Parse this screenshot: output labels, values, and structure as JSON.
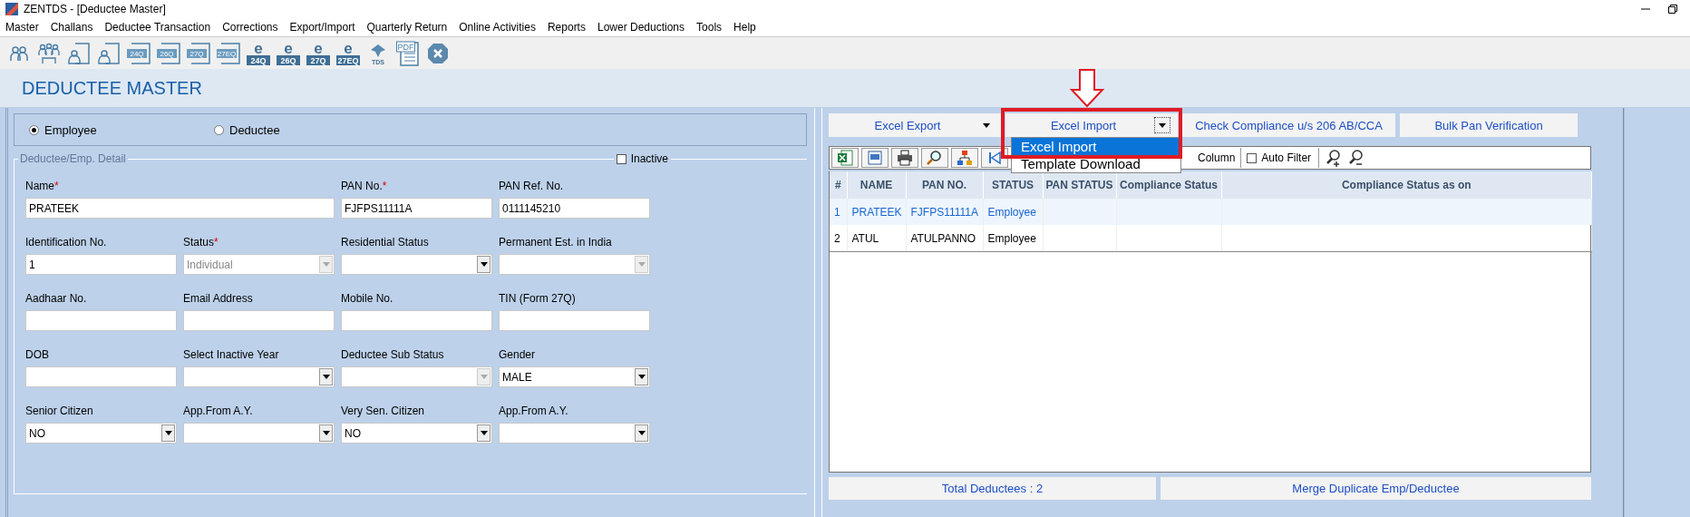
{
  "window": {
    "title": "ZENTDS - [Deductee Master]"
  },
  "menu": [
    "Master",
    "Challans",
    "Deductee Transaction",
    "Corrections",
    "Export/Import",
    "Quarterly Return",
    "Online Activities",
    "Reports",
    "Lower Deductions",
    "Tools",
    "Help"
  ],
  "toolbar": [
    {
      "kind": "person"
    },
    {
      "kind": "group"
    },
    {
      "kind": "person-doc"
    },
    {
      "kind": "person-doc"
    },
    {
      "kind": "form",
      "label": "24Q"
    },
    {
      "kind": "form",
      "label": "26Q"
    },
    {
      "kind": "form",
      "label": "27Q"
    },
    {
      "kind": "form",
      "label": "27EQ"
    },
    {
      "kind": "eform",
      "letter": "e",
      "label": "24Q"
    },
    {
      "kind": "eform",
      "letter": "e",
      "label": "26Q"
    },
    {
      "kind": "eform",
      "letter": "e",
      "label": "27Q"
    },
    {
      "kind": "eform",
      "letter": "e",
      "label": "27EQ"
    },
    {
      "kind": "tds",
      "label": "TDS"
    },
    {
      "kind": "pdf",
      "label": "PDF"
    },
    {
      "kind": "close"
    }
  ],
  "page_title": "DEDUCTEE MASTER",
  "type_options": [
    {
      "label": "Employee",
      "selected": true
    },
    {
      "label": "Deductee",
      "selected": false
    }
  ],
  "detail": {
    "legend": "Deductee/Emp. Detail",
    "inactive": {
      "label": "Inactive",
      "checked": false
    },
    "fields": [
      {
        "label": "Name",
        "required_mark": "*",
        "kind": "wide-text",
        "value": "PRATEEK"
      },
      {
        "label": "PAN No.",
        "required_mark": "*",
        "kind": "text",
        "value": "FJFPS11111A"
      },
      {
        "label": "PAN Ref. No.",
        "kind": "text",
        "value": "0111145210"
      },
      {
        "label": "Identification No.",
        "kind": "text",
        "value": "1"
      },
      {
        "label": "Status",
        "required_mark": "*",
        "kind": "dropdown",
        "value": "Individual",
        "disabled": true
      },
      {
        "label": "Residential Status",
        "kind": "dropdown",
        "disabled": false
      },
      {
        "label": "Permanent Est. in India",
        "kind": "dropdown",
        "disabled": true
      },
      {
        "label": "Aadhaar No.",
        "kind": "text"
      },
      {
        "label": "Email Address",
        "kind": "text"
      },
      {
        "label": "Mobile No.",
        "kind": "text"
      },
      {
        "label": "TIN (Form 27Q)",
        "kind": "text"
      },
      {
        "label": "DOB",
        "kind": "text"
      },
      {
        "label": "Select Inactive Year",
        "kind": "dropdown",
        "disabled": false
      },
      {
        "label": "Deductee Sub Status",
        "kind": "dropdown",
        "disabled": true
      },
      {
        "label": "Gender",
        "kind": "dropdown",
        "value": "MALE",
        "disabled": false
      },
      {
        "label": "Senior Citizen",
        "kind": "dropdown",
        "value": "NO",
        "disabled": false
      },
      {
        "label": "App.From A.Y.",
        "kind": "dropdown",
        "disabled": false
      },
      {
        "label": "Very Sen. Citizen",
        "kind": "dropdown",
        "value": "NO",
        "disabled": false
      },
      {
        "label": "App.From A.Y.",
        "kind": "dropdown",
        "disabled": false
      }
    ]
  },
  "actions": [
    {
      "label": "Excel Export",
      "kind": "split",
      "annotated": false
    },
    {
      "label": "Excel Import",
      "kind": "split",
      "annotated": true
    },
    {
      "label": "Check Compliance u/s 206 AB/CCA",
      "kind": "plain",
      "annotated": false
    },
    {
      "label": "Bulk Pan Verification",
      "kind": "plain",
      "annotated": false
    }
  ],
  "import_menu": [
    {
      "label": "Excel Import",
      "selected": true
    },
    {
      "label": "Template Download",
      "selected": false
    }
  ],
  "grid_toolbar": {
    "icons": [
      {
        "kind": "excel"
      },
      {
        "kind": "word"
      },
      {
        "kind": "print"
      },
      {
        "kind": "find"
      },
      {
        "kind": "tree"
      },
      {
        "kind": "first"
      }
    ],
    "column_label": "Column",
    "auto_filter": {
      "label": "Auto Filter",
      "checked": false
    },
    "zoom_icons": [
      {
        "kind": "zoom-in"
      },
      {
        "kind": "zoom-out"
      }
    ]
  },
  "table": {
    "columns": [
      "#",
      "NAME",
      "PAN NO.",
      "STATUS",
      "PAN STATUS",
      "Compliance Status",
      "Compliance Status as on"
    ],
    "rows": [
      {
        "cells": [
          "1",
          "PRATEEK",
          "FJFPS11111A",
          "Employee",
          "",
          "",
          ""
        ],
        "selected": true
      },
      {
        "cells": [
          "2",
          "ATUL",
          "ATULPANNO",
          "Employee",
          "",
          "",
          ""
        ],
        "selected": false
      }
    ]
  },
  "footer": [
    "Total Deductees : 2",
    "Merge Duplicate Emp/Deductee"
  ]
}
